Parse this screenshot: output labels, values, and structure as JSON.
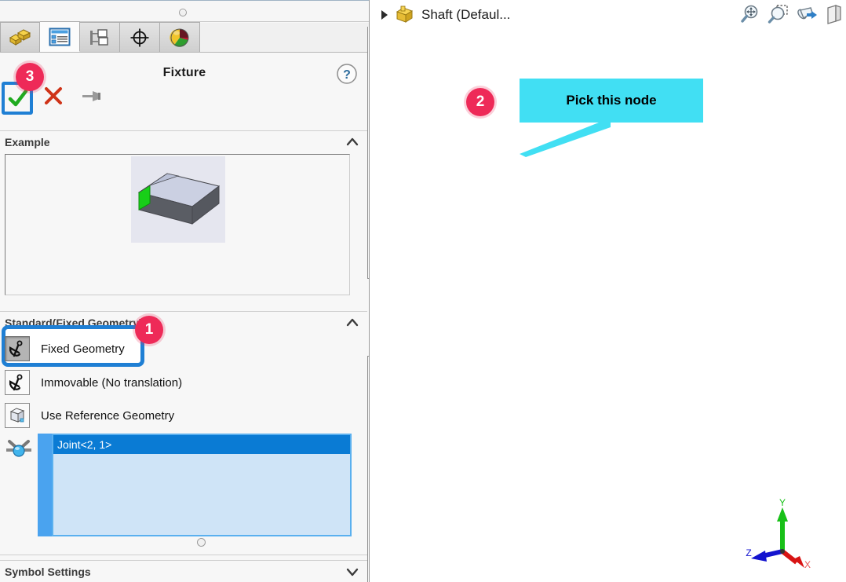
{
  "app": {
    "panel_title": "Fixture",
    "viewport_title": "Shaft  (Defaul..."
  },
  "tabs": [
    {
      "name": "feature-manager-design-tree",
      "icon": "yellow-blocks-icon",
      "active": false
    },
    {
      "name": "property-manager",
      "icon": "blue-list-icon",
      "active": true
    },
    {
      "name": "configuration-manager",
      "icon": "config-tree-icon",
      "active": false
    },
    {
      "name": "dimxpert-manager",
      "icon": "crosshair-icon",
      "active": false
    },
    {
      "name": "display-manager",
      "icon": "color-sphere-icon",
      "active": false
    }
  ],
  "pm_actions": {
    "ok_label": "OK",
    "cancel_label": "Cancel",
    "pin_label": "Keep Visible",
    "help_label": "Help"
  },
  "sections": {
    "example": {
      "title": "Example",
      "collapsed": false,
      "chevron": "chevron-up"
    },
    "standard": {
      "title": "Standard(Fixed Geometry)",
      "collapsed": false,
      "chevron": "chevron-up",
      "options": [
        {
          "label": "Fixed Geometry",
          "icon": "anchor-icon",
          "selected": true
        },
        {
          "label": "Immovable (No translation)",
          "icon": "anchor-icon",
          "selected": false
        },
        {
          "label": "Use Reference Geometry",
          "icon": "cube-reference-icon",
          "selected": false
        }
      ],
      "selection_icon": "vertex-joint-icon",
      "selection_items": [
        {
          "label": "Joint<2, 1>",
          "selected": true
        }
      ]
    },
    "symbol_settings": {
      "title": "Symbol Settings",
      "collapsed": true,
      "chevron": "chevron-down"
    }
  },
  "viewport_tools": [
    {
      "name": "zoom-to-fit-icon",
      "label": "Zoom to Fit"
    },
    {
      "name": "zoom-to-area-icon",
      "label": "Zoom to Area"
    },
    {
      "name": "section-view-icon",
      "label": "Section View"
    },
    {
      "name": "display-style-icon",
      "label": "Display Style"
    }
  ],
  "callout": {
    "text": "Pick this node",
    "background": "#41DFF3"
  },
  "badges": [
    {
      "number": "1",
      "target": "fixed-geometry-option"
    },
    {
      "number": "2",
      "target": "callout-node"
    },
    {
      "number": "3",
      "target": "ok-button"
    }
  ],
  "triad": {
    "x_label": "X",
    "y_label": "Y",
    "z_label": "Z",
    "x_color": "#e01010",
    "y_color": "#10c010",
    "z_color": "#1010d0"
  },
  "model": {
    "name": "Shaft",
    "body_colors": {
      "brass": "#b49012",
      "steel": "#b9bcc6"
    },
    "nodes": [
      {
        "id": "node-1",
        "color": "#7a7a14",
        "position": "shaft-left-end",
        "highlighted": true
      },
      {
        "id": "node-2",
        "color": "#cc22c0",
        "position": "shaft-step-1"
      },
      {
        "id": "node-3",
        "color": "#cc22c0",
        "position": "shaft-step-2"
      },
      {
        "id": "node-4",
        "color": "#7a7a14",
        "position": "shaft-right-end"
      }
    ]
  },
  "colors": {
    "accent_blue": "#1F7FD4",
    "badge_pink": "#EE2A58",
    "select_blue": "#0A7BD4",
    "listbox_bg": "#CFE4F7"
  }
}
